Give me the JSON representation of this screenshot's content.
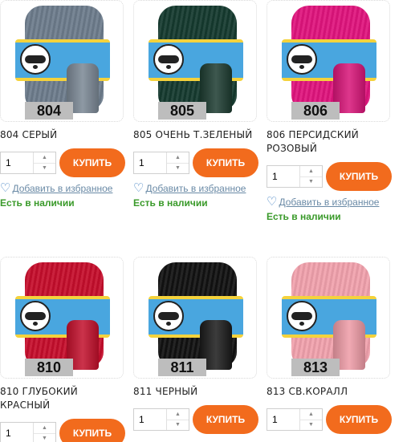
{
  "products": [
    {
      "code": "804",
      "title": "804 СЕРЫЙ",
      "yarn_color": "#6d7c8c",
      "cone_color": "#7a8794",
      "qty": "1",
      "buy_label": "КУПИТЬ",
      "fav_label": "Добавить в избранное",
      "stock_label": "Есть в наличии"
    },
    {
      "code": "805",
      "title": "805 ОЧЕНЬ Т.ЗЕЛЕНЫЙ",
      "yarn_color": "#153a2f",
      "cone_color": "#1c3b30",
      "qty": "1",
      "buy_label": "КУПИТЬ",
      "fav_label": "Добавить в избранное",
      "stock_label": "Есть в наличии"
    },
    {
      "code": "806",
      "title": "806 ПЕРСИДСКИЙ РОЗОВЫЙ",
      "yarn_color": "#e0147d",
      "cone_color": "#d81478",
      "qty": "1",
      "buy_label": "КУПИТЬ",
      "fav_label": "Добавить в избранное",
      "stock_label": "Есть в наличии"
    },
    {
      "code": "810",
      "title": "810 ГЛУБОКИЙ КРАСНЫЙ",
      "yarn_color": "#c50e2c",
      "cone_color": "#c20f2b",
      "qty": "1",
      "buy_label": "КУПИТЬ"
    },
    {
      "code": "811",
      "title": "811 ЧЕРНЫЙ",
      "yarn_color": "#121212",
      "cone_color": "#1a1a1a",
      "qty": "1",
      "buy_label": "КУПИТЬ"
    },
    {
      "code": "813",
      "title": "813 СВ.КОРАЛЛ",
      "yarn_color": "#f1a2ad",
      "cone_color": "#ee9ba6",
      "qty": "1",
      "buy_label": "КУПИТЬ"
    }
  ],
  "colors": {
    "buy_button": "#f26b1d",
    "in_stock": "#3a9a2a",
    "favorite_link": "#6a8aa6"
  },
  "icons": {
    "favorite": "heart-outline-icon",
    "step_up": "caret-up-icon",
    "step_down": "caret-down-icon"
  }
}
